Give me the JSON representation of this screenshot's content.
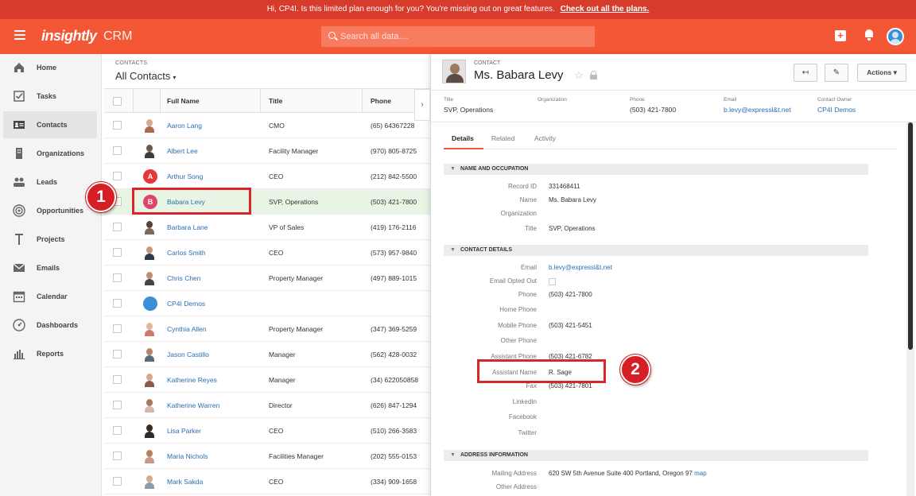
{
  "banner": {
    "text": "Hi, CP4I. Is this limited plan enough for you? You're missing out on great features.",
    "link": "Check out all the plans."
  },
  "navbar": {
    "logo": "insightly",
    "product": "CRM",
    "search_placeholder": "Search all data....",
    "add_label": "+"
  },
  "sidebar": {
    "items": [
      {
        "label": "Home",
        "icon": "home-icon"
      },
      {
        "label": "Tasks",
        "icon": "tasks-icon"
      },
      {
        "label": "Contacts",
        "icon": "contacts-icon"
      },
      {
        "label": "Organizations",
        "icon": "organizations-icon"
      },
      {
        "label": "Leads",
        "icon": "leads-icon"
      },
      {
        "label": "Opportunities",
        "icon": "opportunities-icon"
      },
      {
        "label": "Projects",
        "icon": "projects-icon"
      },
      {
        "label": "Emails",
        "icon": "emails-icon"
      },
      {
        "label": "Calendar",
        "icon": "calendar-icon"
      },
      {
        "label": "Dashboards",
        "icon": "dashboards-icon"
      },
      {
        "label": "Reports",
        "icon": "reports-icon"
      }
    ],
    "active": "Contacts"
  },
  "list": {
    "kicker": "CONTACTS",
    "title": "All Contacts",
    "columns": [
      "Full Name",
      "Title",
      "Phone"
    ],
    "rows": [
      {
        "name": "Aaron Lang",
        "title": "CMO",
        "phone": "(65) 64367228"
      },
      {
        "name": "Albert Lee",
        "title": "Facility Manager",
        "phone": "(970) 805-8725"
      },
      {
        "name": "Arthur Song",
        "title": "CEO",
        "phone": "(212) 842-5500",
        "initial": "A"
      },
      {
        "name": "Babara Levy",
        "title": "SVP, Operations",
        "phone": "(503) 421-7800",
        "initial": "B"
      },
      {
        "name": "Barbara Lane",
        "title": "VP of Sales",
        "phone": "(419) 176-2116"
      },
      {
        "name": "Carlos Smith",
        "title": "CEO",
        "phone": "(573) 957-9840"
      },
      {
        "name": "Chris Chen",
        "title": "Property Manager",
        "phone": "(497) 889-1015"
      },
      {
        "name": "CP4I Demos",
        "title": "",
        "phone": ""
      },
      {
        "name": "Cynthia Allen",
        "title": "Property Manager",
        "phone": "(347) 369-5259"
      },
      {
        "name": "Jason Castillo",
        "title": "Manager",
        "phone": "(562) 428-0032"
      },
      {
        "name": "Katherine Reyes",
        "title": "Manager",
        "phone": "(34) 622050858"
      },
      {
        "name": "Katherine Warren",
        "title": "Director",
        "phone": "(626) 847-1294"
      },
      {
        "name": "Lisa Parker",
        "title": "CEO",
        "phone": "(510) 266-3583"
      },
      {
        "name": "Maria Nichols",
        "title": "Facilities Manager",
        "phone": "(202) 555-0153"
      },
      {
        "name": "Mark Sakda",
        "title": "CEO",
        "phone": "(334) 909-1658"
      }
    ],
    "collapse_icon": "chevron-right-icon"
  },
  "detail": {
    "kicker": "CONTACT",
    "name": "Ms. Babara Levy",
    "star": "☆",
    "actions_label": "Actions",
    "back_glyph": "↤",
    "edit_glyph": "✎",
    "summary": {
      "title_label": "Title",
      "title_value": "SVP, Operations",
      "org_label": "Organization",
      "org_value": "",
      "phone_label": "Phone",
      "phone_value": "(503) 421-7800",
      "email_label": "Email",
      "email_value": "b.levy@expressl&t.net",
      "owner_label": "Contact Owner",
      "owner_value": "CP4I Demos"
    },
    "tabs": [
      "Details",
      "Related",
      "Activity"
    ],
    "sections": {
      "name_occupation": "NAME AND OCCUPATION",
      "contact_details": "CONTACT DETAILS",
      "address_information": "ADDRESS INFORMATION"
    },
    "fields": {
      "record_id_label": "Record ID",
      "record_id": "331468411",
      "name_label": "Name",
      "name": "Ms. Babara Levy",
      "organization_label": "Organization",
      "title_label": "Title",
      "title": "SVP, Operations",
      "email_label": "Email",
      "email": "b.levy@expressl&t.net",
      "email_opted_out_label": "Email Opted Out",
      "phone_label": "Phone",
      "phone": "(503) 421-7800",
      "home_phone_label": "Home Phone",
      "mobile_phone_label": "Mobile Phone",
      "mobile_phone": "(503) 421-5451",
      "other_phone_label": "Other Phone",
      "assistant_phone_label": "Assistant Phone",
      "assistant_phone": "(503) 421-6782",
      "assistant_name_label": "Assistant Name",
      "assistant_name": "R. Sage",
      "fax_label": "Fax",
      "fax": "(503) 421-7801",
      "linkedin_label": "LinkedIn",
      "facebook_label": "Facebook",
      "twitter_label": "Twitter",
      "mailing_address_label": "Mailing Address",
      "mailing_address": "620 SW 5th Avenue Suite 400 Portland, Oregon 97",
      "map_link": "map",
      "other_address_label": "Other Address"
    }
  },
  "annotations": {
    "marker1": "1",
    "marker2": "2",
    "highlight_color": "#d9262b"
  },
  "colors": {
    "brand": "#f35735",
    "banner": "#d63b2b",
    "link": "#2a6db5",
    "selected_row": "#e8f5e4"
  }
}
